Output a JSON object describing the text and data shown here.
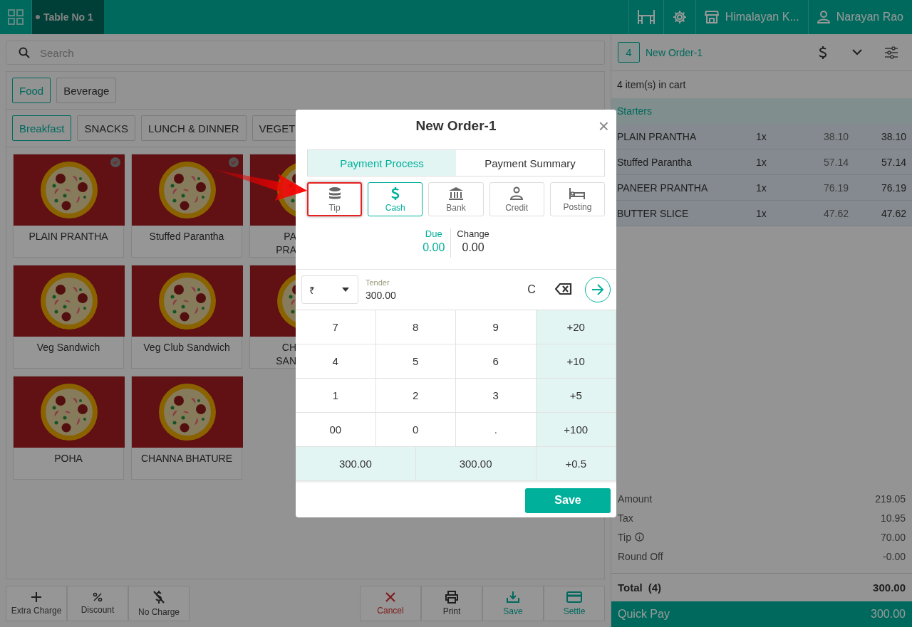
{
  "top_bar": {
    "table_tab": "Table No 1",
    "store": "Himalayan K...",
    "user": "Narayan Rao"
  },
  "search": {
    "placeholder": "Search"
  },
  "menu_tabs": [
    {
      "label": "Food",
      "selected": true
    },
    {
      "label": "Beverage",
      "selected": false
    }
  ],
  "category_tabs": [
    {
      "label": "Breakfast",
      "selected": true
    },
    {
      "label": "SNACKS",
      "selected": false
    },
    {
      "label": "LUNCH & DINNER",
      "selected": false
    },
    {
      "label": "VEGET",
      "selected": false
    }
  ],
  "products": [
    {
      "name": "PLAIN PRANTHA",
      "selected": true
    },
    {
      "name": "Stuffed Parantha",
      "selected": true
    },
    {
      "name_lines": [
        "PA",
        "PRA"
      ]
    },
    {
      "name": "Veg Sandwich",
      "selected": false
    },
    {
      "name": "Veg Club Sandwich",
      "selected": false
    },
    {
      "name_lines": [
        "CH",
        "SAN"
      ]
    },
    {
      "name": "POHA",
      "selected": false
    },
    {
      "name": "CHANNA BHATURE",
      "selected": false
    }
  ],
  "left_actions": [
    {
      "label": "Extra Charge",
      "kind": "plus"
    },
    {
      "label": "Discount",
      "kind": "percent"
    },
    {
      "label": "No Charge",
      "kind": "nocharge"
    }
  ],
  "right_actions": [
    {
      "label": "Cancel",
      "kind": "cancel"
    },
    {
      "label": "Print",
      "kind": "print"
    },
    {
      "label": "Save",
      "kind": "save"
    },
    {
      "label": "Settle",
      "kind": "settle"
    }
  ],
  "cart": {
    "count": "4",
    "title": "New Order-1",
    "items_text": "4 item(s) in cart",
    "group": "Starters",
    "items": [
      {
        "name": "PLAIN PRANTHA",
        "qty": "1x",
        "price": "38.10",
        "total": "38.10"
      },
      {
        "name": "Stuffed Parantha",
        "qty": "1x",
        "price": "57.14",
        "total": "57.14"
      },
      {
        "name": "PANEER PRANTHA",
        "qty": "1x",
        "price": "76.19",
        "total": "76.19"
      },
      {
        "name": "BUTTER SLICE",
        "qty": "1x",
        "price": "47.62",
        "total": "47.62"
      }
    ],
    "summary": [
      {
        "label": "Amount",
        "value": "219.05",
        "info": false
      },
      {
        "label": "Tax",
        "value": "10.95",
        "info": false
      },
      {
        "label": "Tip",
        "value": "70.00",
        "info": true
      },
      {
        "label": "Round Off",
        "value": "-0.00",
        "info": false
      }
    ],
    "total": {
      "label": "Total",
      "count": "(4)",
      "value": "300.00"
    },
    "quick_pay": {
      "label": "Quick Pay",
      "value": "300.00"
    }
  },
  "modal": {
    "title": "New Order-1",
    "close": "×",
    "tabs": [
      {
        "label": "Payment Process",
        "selected": true
      },
      {
        "label": "Payment Summary",
        "selected": false
      }
    ],
    "methods": [
      {
        "label": "Tip",
        "kind": "tip",
        "selected": false,
        "highlighted": true
      },
      {
        "label": "Cash",
        "kind": "cash",
        "selected": true,
        "highlighted": false
      },
      {
        "label": "Bank",
        "kind": "bank",
        "selected": false,
        "highlighted": false
      },
      {
        "label": "Credit",
        "kind": "credit",
        "selected": false,
        "highlighted": false
      },
      {
        "label": "Posting",
        "kind": "posting",
        "selected": false,
        "highlighted": false
      }
    ],
    "due": {
      "label": "Due",
      "value": "0.00"
    },
    "change": {
      "label": "Change",
      "value": "0.00"
    },
    "currency": "₹",
    "tender": {
      "label": "Tender",
      "value": "300.00"
    },
    "clear": "C",
    "keypad": [
      {
        "label": "7",
        "kind": "digit"
      },
      {
        "label": "8",
        "kind": "digit"
      },
      {
        "label": "9",
        "kind": "digit"
      },
      {
        "label": "+20",
        "kind": "quick"
      },
      {
        "label": "4",
        "kind": "digit"
      },
      {
        "label": "5",
        "kind": "digit"
      },
      {
        "label": "6",
        "kind": "digit"
      },
      {
        "label": "+10",
        "kind": "quick"
      },
      {
        "label": "1",
        "kind": "digit"
      },
      {
        "label": "2",
        "kind": "digit"
      },
      {
        "label": "3",
        "kind": "digit"
      },
      {
        "label": "+5",
        "kind": "quick"
      },
      {
        "label": "00",
        "kind": "digit"
      },
      {
        "label": "0",
        "kind": "digit"
      },
      {
        "label": ".",
        "kind": "digit"
      },
      {
        "label": "+100",
        "kind": "quick"
      }
    ],
    "amounts": [
      {
        "label": "300.00"
      },
      {
        "label": "300.00"
      },
      {
        "label": "+0.5"
      }
    ],
    "save": "Save"
  },
  "annotation_arrow": true
}
